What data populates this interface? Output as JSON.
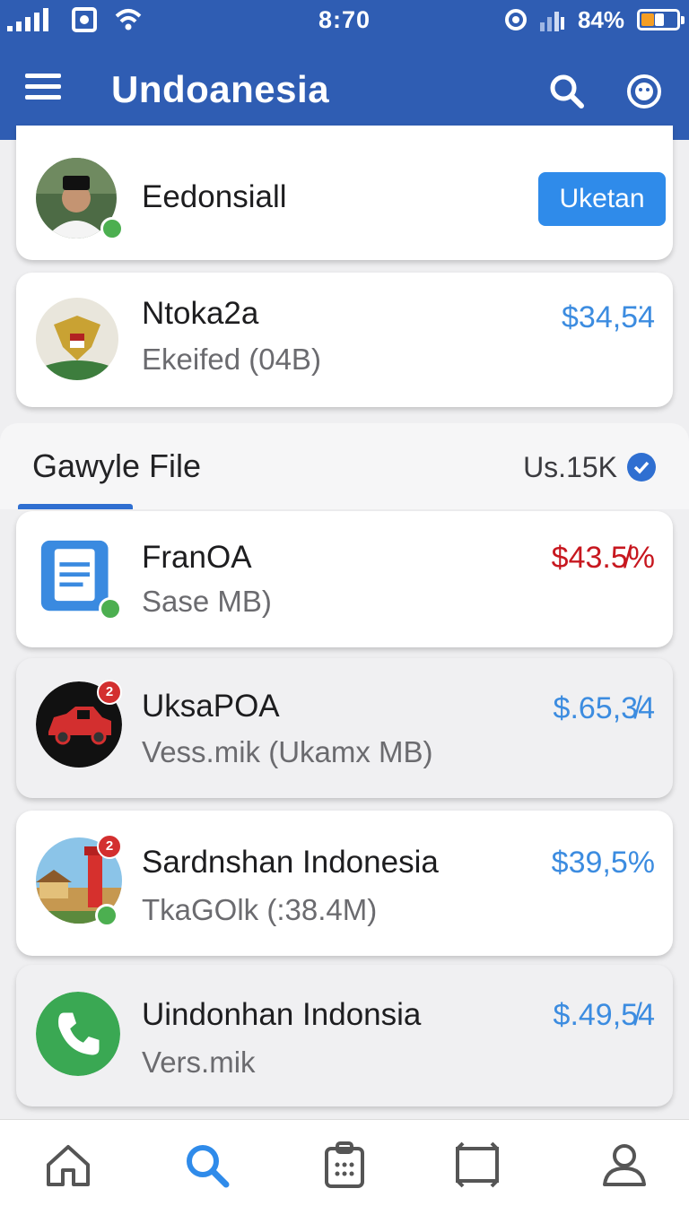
{
  "status_bar": {
    "time": "8:70",
    "battery": "84%",
    "icons": [
      "signal-icon",
      "photo-icon",
      "wifi-icon",
      "alarm-icon",
      "cell-signal-icon",
      "battery-icon"
    ]
  },
  "app_bar": {
    "title": "Undoanesia",
    "icons": [
      "menu-icon",
      "search-icon",
      "account-icon"
    ]
  },
  "profile_card": {
    "name": "Eedonsiall",
    "button_label": "Uketan"
  },
  "balance_card": {
    "name": "Ntoka2a",
    "subtitle": "Ekeifed (04B)",
    "value": "$34,5̈4",
    "value_color": "#3c8ce0"
  },
  "section": {
    "title": "Gawyle File",
    "meta": "Us.15K",
    "check_color": "#2f6fd1"
  },
  "items": [
    {
      "name": "FranOA",
      "subtitle": "Sase MB)",
      "value": "$43.5̸%",
      "value_color": "#c7171f",
      "icon": "document-icon"
    },
    {
      "name": "UksaPOA",
      "subtitle": "Vess.mik (Ukamx MB)",
      "value": "$.65,3̸4",
      "value_color": "#3c8ce0",
      "icon": "car-icon",
      "badge": "2"
    },
    {
      "name": "Sardnshan Indonesia",
      "subtitle": "TkaGOlk (:38.4M)",
      "value": "$39,5%",
      "value_color": "#3c8ce0",
      "icon": "lighthouse-icon",
      "badge": "2"
    },
    {
      "name": "Uindonhan Indonsia",
      "subtitle": "Vers.mik",
      "value": "$.49,5̸4",
      "value_color": "#3c8ce0",
      "icon": "phone-icon"
    }
  ],
  "bottom_nav": [
    "home-icon",
    "search-icon",
    "clipboard-icon",
    "frame-icon",
    "profile-icon"
  ],
  "colors": {
    "primary": "#2f5db3",
    "accent": "#2f8bea",
    "active_nav": "#2f8bea"
  }
}
